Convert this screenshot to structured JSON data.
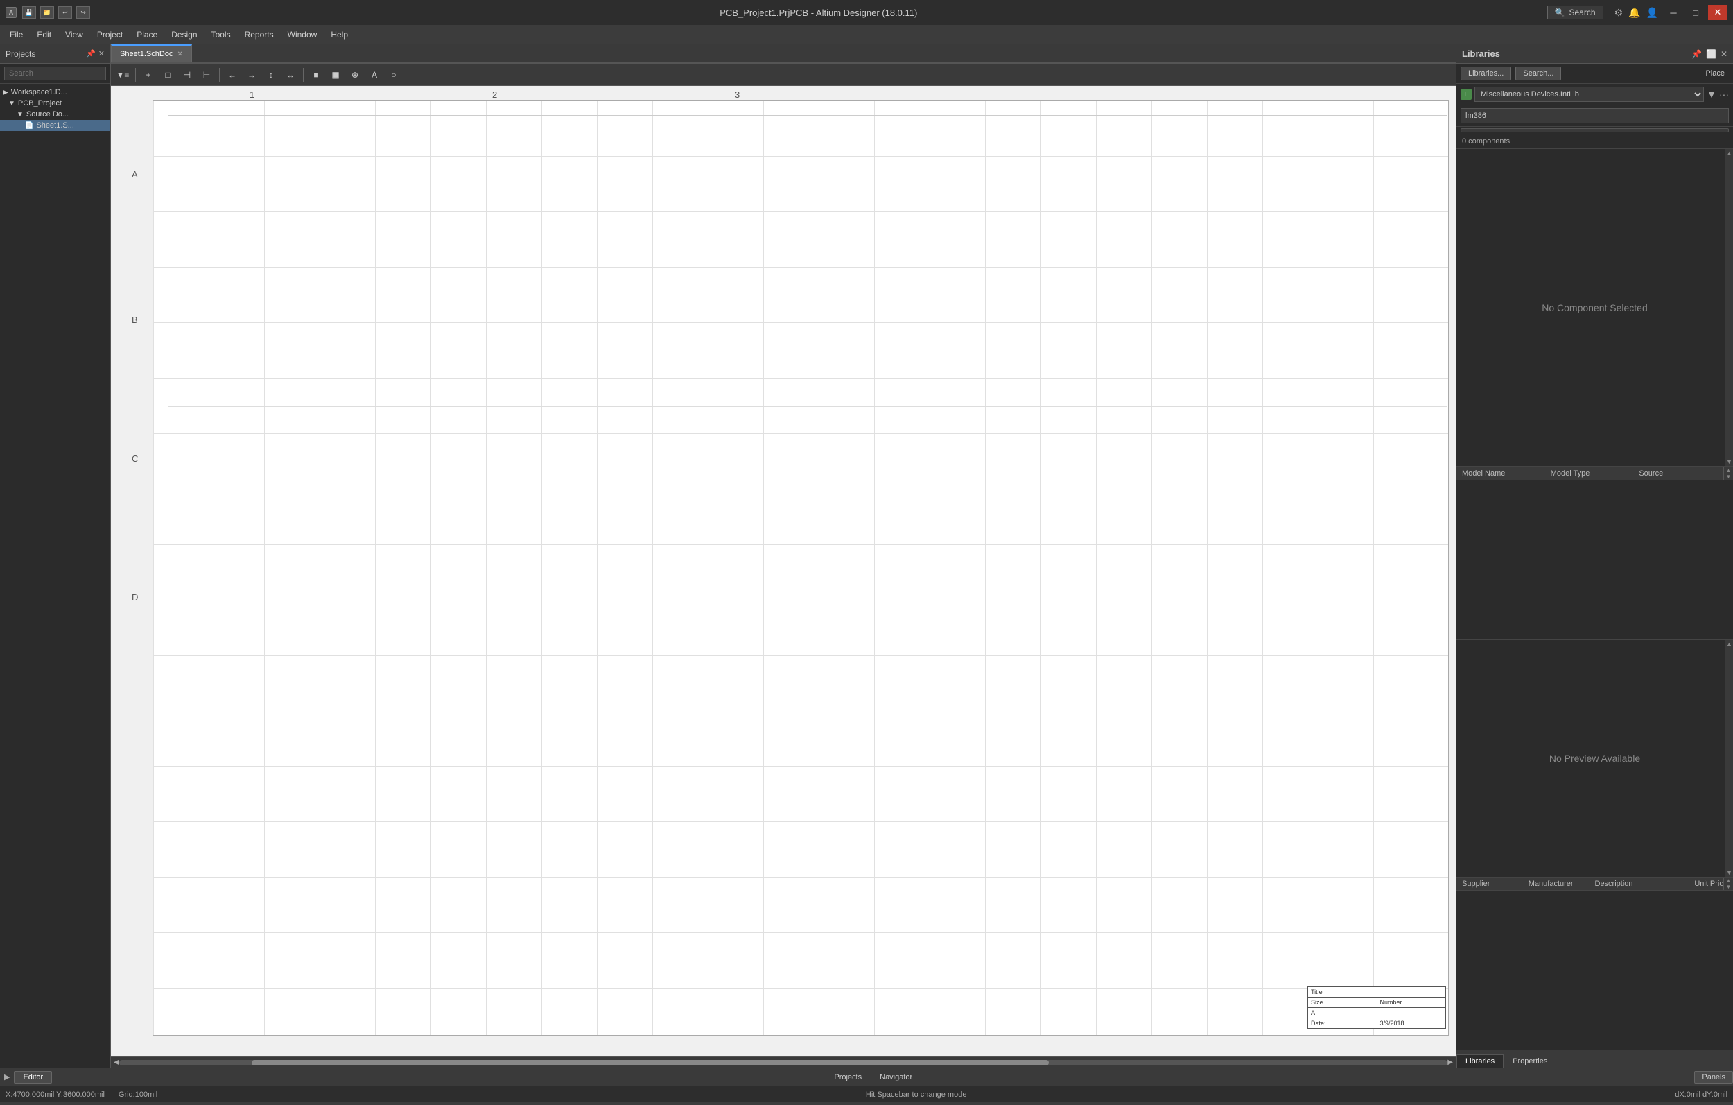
{
  "app": {
    "title": "PCB_Project1.PrjPCB - Altium Designer (18.0.11)",
    "search_placeholder": "Search"
  },
  "titlebar": {
    "title": "PCB_Project1.PrjPCB - Altium Designer (18.0.11)",
    "minimize": "─",
    "maximize": "□",
    "close": "✕"
  },
  "menubar": {
    "items": [
      "File",
      "Edit",
      "View",
      "Project",
      "Place",
      "Design",
      "Tools",
      "Reports",
      "Window",
      "Help"
    ]
  },
  "projects_panel": {
    "title": "Projects",
    "search_placeholder": "Search",
    "tree": [
      {
        "label": "Workspace1.D...",
        "indent": 0,
        "icon": "🗂"
      },
      {
        "label": "PCB_Project",
        "indent": 1,
        "icon": "📋"
      },
      {
        "label": "Source Do...",
        "indent": 2,
        "icon": "📁"
      },
      {
        "label": "Sheet1.S...",
        "indent": 3,
        "icon": "📄"
      }
    ]
  },
  "tabs": [
    {
      "label": "Sheet1.SchDoc",
      "active": true
    }
  ],
  "toolbar": {
    "buttons": [
      "⊞",
      "+",
      "□",
      "⊣",
      "⊢",
      "⟵",
      "⟶",
      "⊥",
      "⊤",
      "↕",
      "↔",
      "■",
      "▣",
      "⊕",
      "A",
      "○"
    ]
  },
  "canvas": {
    "row_labels": [
      "A",
      "B",
      "C",
      "D"
    ],
    "col_nums": [
      "1",
      "2",
      "3"
    ],
    "title_block": {
      "title_label": "Title",
      "size_label": "Size",
      "size_val": "A",
      "number_label": "Number",
      "date_label": "Date",
      "date_val": "3/9/2018"
    }
  },
  "libraries_panel": {
    "title": "Libraries",
    "btn_libraries": "Libraries...",
    "btn_search": "Search...",
    "btn_place": "Place",
    "selected_lib": "Miscellaneous Devices.IntLib",
    "search_value": "lm386",
    "comp_count": "0 components",
    "no_component": "No Component Selected",
    "model_table": {
      "headers": [
        "Model Name",
        "Model Type",
        "Source"
      ]
    },
    "no_preview": "No Preview Available",
    "supplier_table": {
      "headers": [
        "Supplier",
        "Manufacturer",
        "Description",
        "Unit Price"
      ]
    },
    "bottom_tabs": [
      "Libraries",
      "Properties"
    ]
  },
  "statusbar": {
    "coords": "X:4700.000mil Y:3600.000mil",
    "grid": "Grid:100mil",
    "hint": "Hit Spacebar to change mode",
    "delta": "dX:0mil dY:0mil"
  },
  "bottom_tabs": [
    "Editor"
  ],
  "bottom_left_tabs": [
    "Projects",
    "Navigator"
  ],
  "panels_btn": "Panels"
}
